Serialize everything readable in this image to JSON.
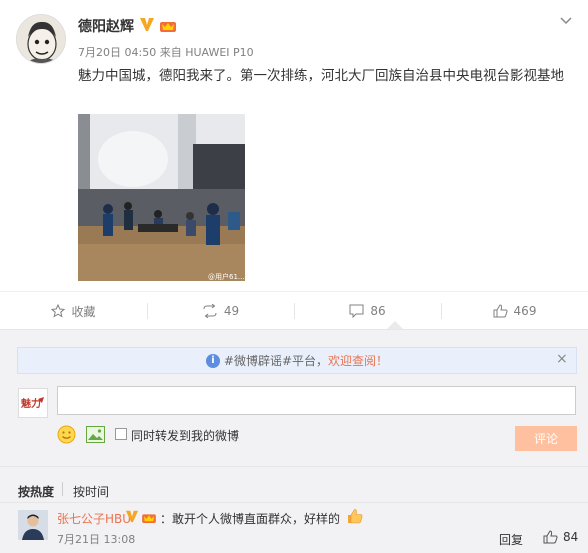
{
  "post": {
    "author": "德阳赵辉",
    "time": "7月20日 04:50",
    "source_prefix": "来自",
    "source": "HUAWEI P10",
    "text": "魅力中国城，德阳我来了。第一次排练，河北大厂回族自治县中央电视台影视基地",
    "photo_watermark": "@用户61..."
  },
  "actions": {
    "favorite": "收藏",
    "repost_count": "49",
    "comment_count": "86",
    "like_count": "469"
  },
  "notice": {
    "prefix": "#微博辟谣#平台，",
    "highlight": "欢迎查阅！",
    "close": "×"
  },
  "composer": {
    "input_value": "",
    "repost_label": "同时转发到我的微博",
    "submit_label": "评论"
  },
  "sort": {
    "hot": "按热度",
    "time": "按时间"
  },
  "comments": [
    {
      "name": "张七公子HBU",
      "text": "：敢开个人微博直面群众，好样的",
      "time": "7月21日 13:08",
      "reply": "回复",
      "likes": "84"
    }
  ],
  "colors": {
    "accent_orange": "#eb7350",
    "submit_disabled": "#ffc09f",
    "notice_bg": "#e9f0fb"
  }
}
